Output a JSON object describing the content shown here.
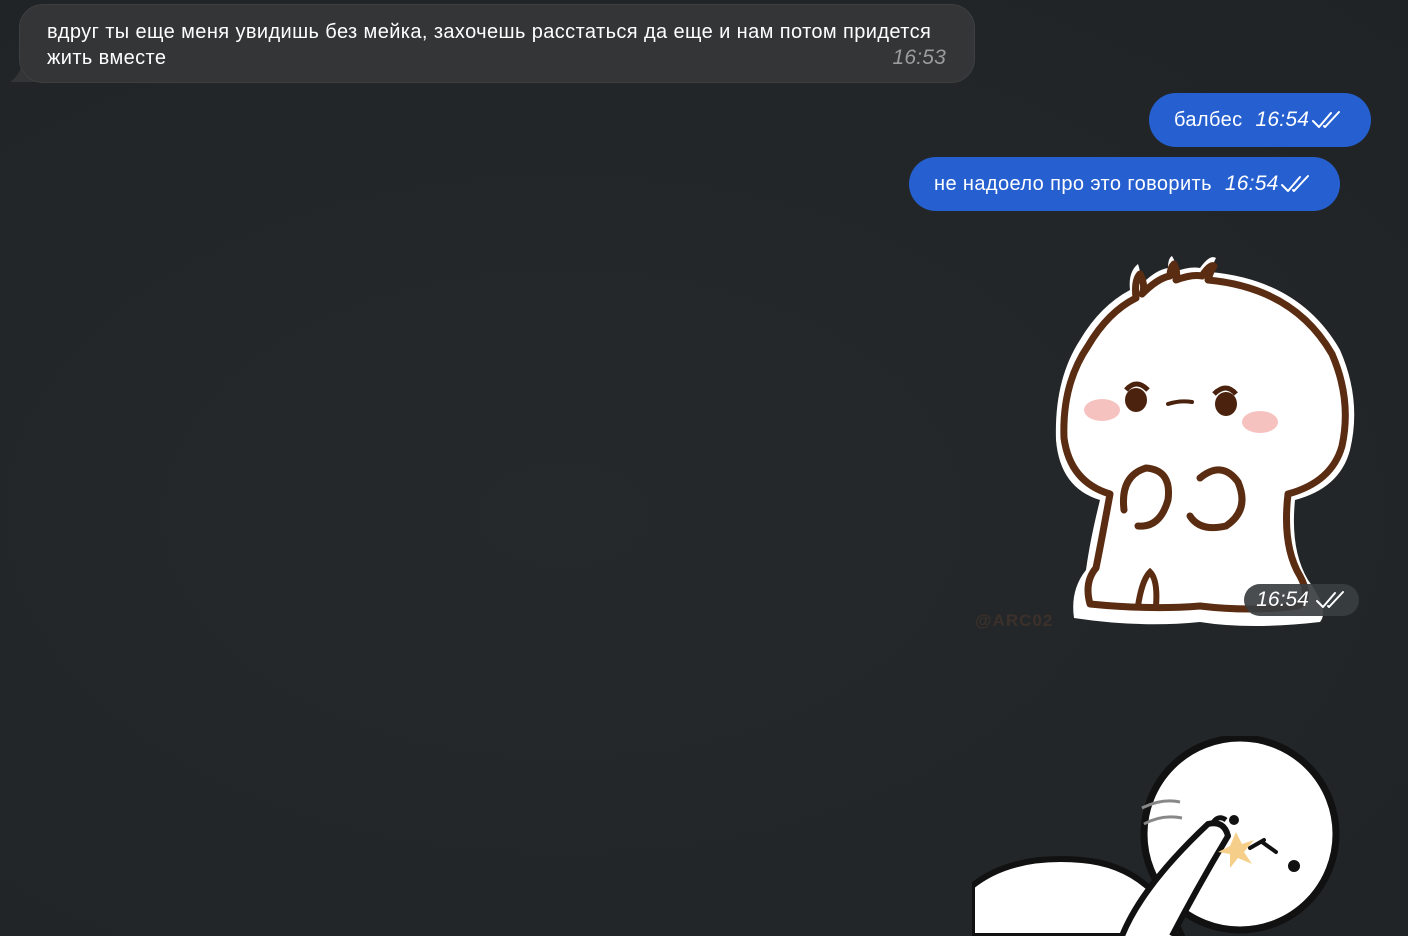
{
  "messages": {
    "incoming_1": {
      "text": "вдруг ты еще меня увидишь без мейка, захочешь расстаться да еще и нам потом придется жить вместе",
      "time": "16:53"
    },
    "outgoing_1": {
      "text": "балбес",
      "time": "16:54",
      "status": "read"
    },
    "outgoing_2": {
      "text": "не надоело про это говорить",
      "time": "16:54",
      "status": "read"
    },
    "sticker_1": {
      "time": "16:54",
      "status": "read",
      "watermark": "@ARC02"
    }
  },
  "colors": {
    "background": "#23272a",
    "incoming_bubble": "#333536",
    "outgoing_bubble": "#2660d0",
    "sticker_outline": "#5a2c12"
  },
  "icons": {
    "read_status": "double-check-icon"
  }
}
